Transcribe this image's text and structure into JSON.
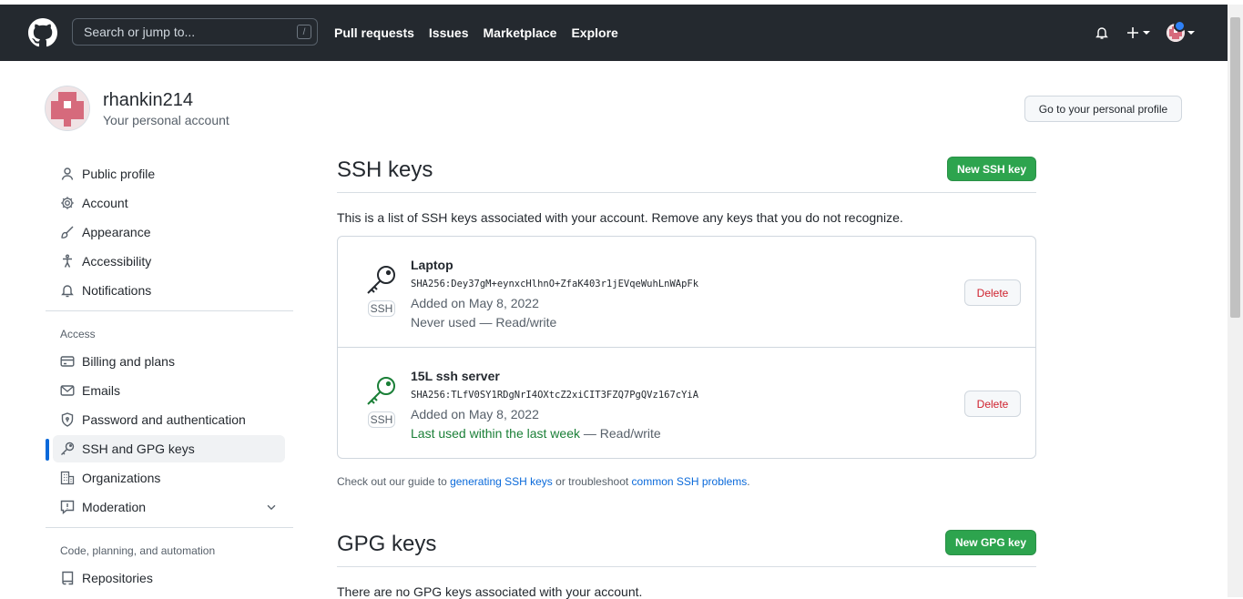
{
  "header": {
    "search_placeholder": "Search or jump to...",
    "search_shortcut": "/",
    "nav": [
      "Pull requests",
      "Issues",
      "Marketplace",
      "Explore"
    ]
  },
  "account": {
    "username": "rhankin214",
    "subtitle": "Your personal account",
    "profile_button": "Go to your personal profile"
  },
  "sidebar": {
    "items": [
      {
        "label": "Public profile",
        "icon": "person-icon"
      },
      {
        "label": "Account",
        "icon": "gear-icon"
      },
      {
        "label": "Appearance",
        "icon": "paintbrush-icon"
      },
      {
        "label": "Accessibility",
        "icon": "accessibility-icon"
      },
      {
        "label": "Notifications",
        "icon": "bell-icon"
      }
    ],
    "access_heading": "Access",
    "access_items": [
      {
        "label": "Billing and plans",
        "icon": "credit-card-icon"
      },
      {
        "label": "Emails",
        "icon": "mail-icon"
      },
      {
        "label": "Password and authentication",
        "icon": "shield-lock-icon"
      },
      {
        "label": "SSH and GPG keys",
        "icon": "key-icon"
      },
      {
        "label": "Organizations",
        "icon": "organization-icon"
      },
      {
        "label": "Moderation",
        "icon": "report-icon"
      }
    ],
    "code_heading": "Code, planning, and automation",
    "code_items": [
      {
        "label": "Repositories",
        "icon": "repo-icon"
      }
    ]
  },
  "ssh": {
    "title": "SSH keys",
    "new_button": "New SSH key",
    "description": "This is a list of SSH keys associated with your account. Remove any keys that you do not recognize.",
    "keys": [
      {
        "name": "Laptop",
        "fingerprint": "SHA256:Dey37gM+eynxcHlhnO+ZfaK403r1jEVqeWuhLnWApFk",
        "added": "Added on May 8, 2022",
        "usage": "Never used",
        "access": " — Read/write",
        "type": "SSH",
        "delete_label": "Delete",
        "icon_color": "#24292f"
      },
      {
        "name": "15L ssh server",
        "fingerprint": "SHA256:TLfV0SY1RDgNrI4OXtcZ2xiCIT3FZQ7PgQVz167cYiA",
        "added": "Added on May 8, 2022",
        "usage": "Last used within the last week",
        "access": " — Read/write",
        "type": "SSH",
        "delete_label": "Delete",
        "icon_color": "#1a7f37"
      }
    ],
    "guide_prefix": "Check out our guide to ",
    "guide_link1": "generating SSH keys",
    "guide_middle": " or troubleshoot ",
    "guide_link2": "common SSH problems",
    "guide_suffix": "."
  },
  "gpg": {
    "title": "GPG keys",
    "new_button": "New GPG key",
    "description": "There are no GPG keys associated with your account."
  }
}
